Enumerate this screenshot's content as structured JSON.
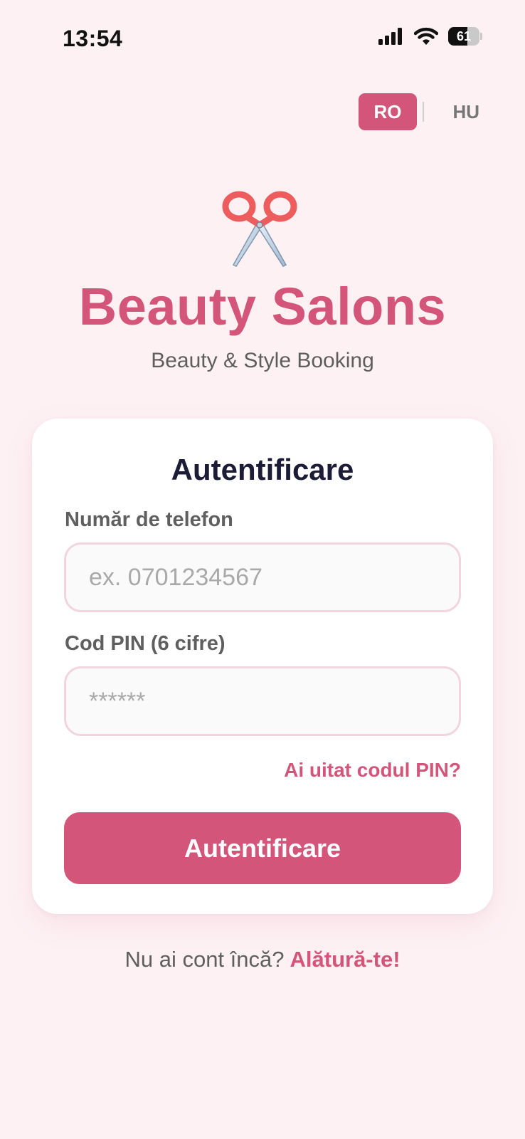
{
  "status_bar": {
    "time": "13:54",
    "battery_level": "61"
  },
  "language": {
    "options": [
      "RO",
      "HU"
    ],
    "selected": "RO"
  },
  "brand": {
    "icon": "scissors-icon",
    "title": "Beauty Salons",
    "subtitle": "Beauty & Style Booking"
  },
  "login": {
    "title": "Autentificare",
    "phone_label": "Număr de telefon",
    "phone_placeholder": "ex. 0701234567",
    "phone_value": "",
    "pin_label": "Cod PIN (6 cifre)",
    "pin_placeholder": "******",
    "pin_value": "",
    "forgot_pin": "Ai uitat codul PIN?",
    "submit_label": "Autentificare"
  },
  "signup": {
    "prompt": "Nu ai cont încă?",
    "link": "Alătură-te!"
  },
  "colors": {
    "accent": "#d3567a",
    "background": "#fdf1f4",
    "card": "#ffffff",
    "heading": "#1c1c36",
    "muted": "#5f5f5f"
  }
}
